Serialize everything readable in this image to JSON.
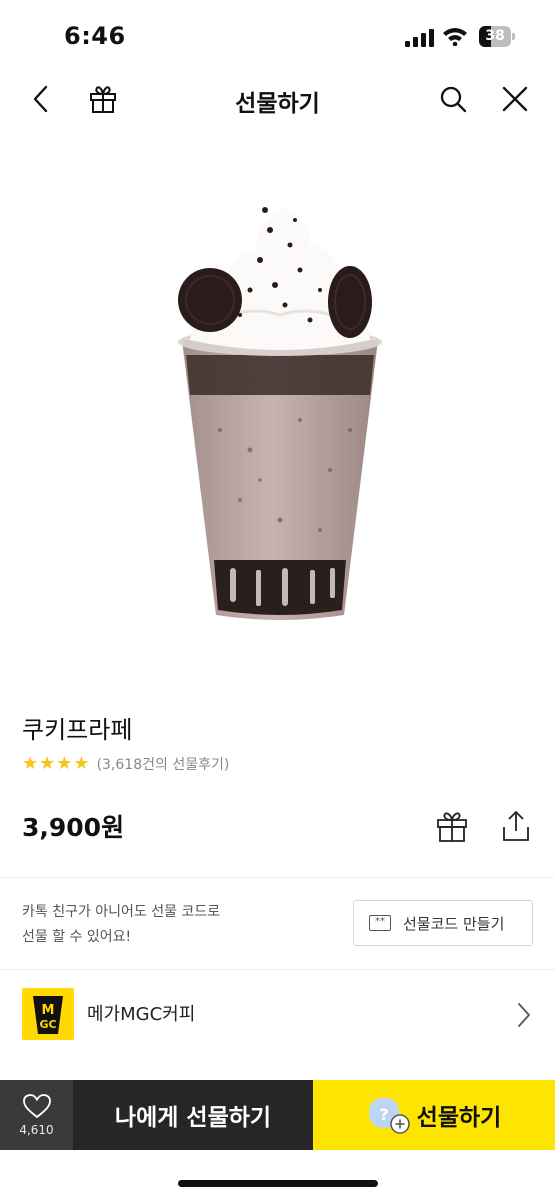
{
  "status_bar": {
    "time": "6:46",
    "battery_level": "38",
    "battery_fraction": 0.38
  },
  "nav": {
    "title": "선물하기",
    "back_icon": "chevron-left-icon",
    "gift_icon": "gift-icon",
    "search_icon": "search-icon",
    "close_icon": "close-icon"
  },
  "product": {
    "name": "쿠키프라페",
    "rating_stars": 4,
    "review_count_text": "(3,618건의 선물후기)",
    "price": "3,900원"
  },
  "gift_code": {
    "description_line1": "카톡 친구가 아니어도 선물 코드로",
    "description_line2": "선물 할 수 있어요!",
    "button_label": "선물코드 만들기",
    "button_icon_text": "**"
  },
  "brand": {
    "name": "메가MGC커피",
    "logo_text_top": "M",
    "logo_text_bottom": "GC"
  },
  "bottom_bar": {
    "like_count": "4,610",
    "gift_to_me_label": "나에게 선물하기",
    "gift_label": "선물하기",
    "gift_icon_text": "?"
  },
  "colors": {
    "accent_yellow": "#fee500",
    "star_yellow": "#f5c518",
    "dark_button": "#262626",
    "like_box": "#3a3a3a"
  }
}
